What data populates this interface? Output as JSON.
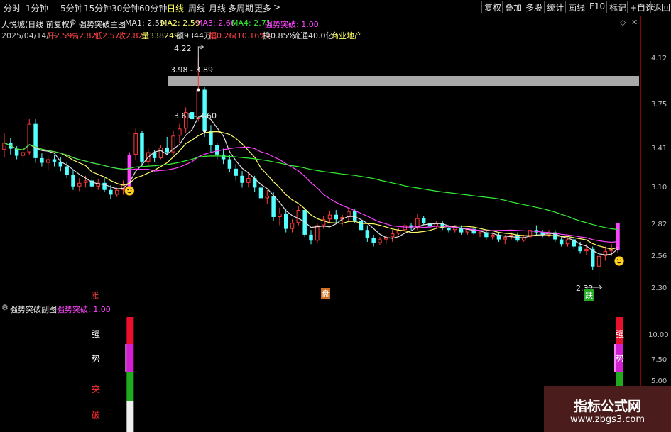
{
  "toolbar": {
    "periods": [
      "分时",
      "1分钟",
      "5分钟",
      "15分钟",
      "30分钟",
      "60分钟",
      "日线",
      "周线",
      "月线",
      "多周期",
      "更多"
    ],
    "active_period": "日线",
    "right_buttons": [
      "复权",
      "叠加",
      "多股",
      "统计",
      "画线",
      "F10",
      "标记",
      "+自选",
      "返回"
    ]
  },
  "header": {
    "stock": "大悦城(日线 前复权)",
    "indicator_name": "强势突破主图",
    "ma1": "MA1: 2.59",
    "ma2": "MA2: 2.59",
    "ma3": "MA3: 2.66",
    "ma4": "MA4: 2.71",
    "signal": "强势突破: 1.00",
    "date": "2025/04/14/一",
    "open": "开2.59",
    "high": "高2.82",
    "low": "低2.57",
    "close": "收2.82",
    "volume": "量338249",
    "amount": "额9344万",
    "change": "幅0.26(10.16%)",
    "turnover": "换0.85%",
    "float": "流通40.0亿",
    "sector": "商业地产"
  },
  "main_axis": [
    "4.12",
    "3.75",
    "3.41",
    "3.10",
    "2.82",
    "2.56",
    "2.30"
  ],
  "price_labels": {
    "high": "4.22",
    "zone1": "3.98 - 3.89",
    "zone2": "3.61 - 3.60",
    "low": "2.32"
  },
  "markers": {
    "zhang": "涨",
    "pan": "盘",
    "die": "跌"
  },
  "sub": {
    "title": "强势突破副图",
    "value": "强势突破: 1.00",
    "axis": [
      "10.00",
      "7.50",
      "5.00"
    ],
    "chars": [
      "强",
      "势",
      "突",
      "破"
    ]
  },
  "colors": {
    "up": "#ff3c3c",
    "down": "#54ffff",
    "ma1": "#e0e0e0",
    "ma2": "#ffff66",
    "ma3": "#ff44ff",
    "ma4": "#33ee33",
    "signal": "#ff44ff"
  },
  "chart_data": {
    "type": "candlestick",
    "ylim": [
      2.22,
      4.35
    ],
    "candles": [
      [
        3.44,
        3.58,
        3.38,
        3.5
      ],
      [
        3.5,
        3.54,
        3.4,
        3.45
      ],
      [
        3.45,
        3.47,
        3.36,
        3.39
      ],
      [
        3.39,
        3.45,
        3.3,
        3.42
      ],
      [
        3.42,
        3.7,
        3.4,
        3.66
      ],
      [
        3.66,
        3.7,
        3.33,
        3.37
      ],
      [
        3.37,
        3.41,
        3.3,
        3.33
      ],
      [
        3.33,
        3.39,
        3.27,
        3.36
      ],
      [
        3.36,
        3.4,
        3.3,
        3.34
      ],
      [
        3.34,
        3.38,
        3.26,
        3.3
      ],
      [
        3.3,
        3.34,
        3.2,
        3.23
      ],
      [
        3.23,
        3.27,
        3.1,
        3.13
      ],
      [
        3.13,
        3.2,
        3.09,
        3.16
      ],
      [
        3.16,
        3.22,
        3.12,
        3.18
      ],
      [
        3.18,
        3.22,
        3.1,
        3.13
      ],
      [
        3.13,
        3.19,
        3.1,
        3.16
      ],
      [
        3.16,
        3.2,
        3.08,
        3.1
      ],
      [
        3.1,
        3.14,
        3.02,
        3.06
      ],
      [
        3.06,
        3.12,
        3.04,
        3.1
      ],
      [
        3.1,
        3.18,
        3.06,
        3.15
      ],
      [
        3.12,
        3.42,
        3.1,
        3.4
      ],
      [
        3.4,
        3.62,
        3.35,
        3.58
      ],
      [
        3.58,
        3.6,
        3.3,
        3.34
      ],
      [
        3.34,
        3.45,
        3.3,
        3.42
      ],
      [
        3.42,
        3.44,
        3.34,
        3.37
      ],
      [
        3.37,
        3.48,
        3.36,
        3.46
      ],
      [
        3.46,
        3.55,
        3.4,
        3.42
      ],
      [
        3.42,
        3.6,
        3.4,
        3.56
      ],
      [
        3.56,
        3.66,
        3.5,
        3.62
      ],
      [
        3.62,
        3.8,
        3.58,
        3.76
      ],
      [
        3.76,
        3.98,
        3.6,
        3.7
      ],
      [
        3.7,
        4.22,
        3.68,
        3.95
      ],
      [
        3.95,
        3.97,
        3.55,
        3.6
      ],
      [
        3.6,
        3.65,
        3.42,
        3.48
      ],
      [
        3.48,
        3.5,
        3.36,
        3.4
      ],
      [
        3.4,
        3.45,
        3.32,
        3.36
      ],
      [
        3.36,
        3.4,
        3.25,
        3.28
      ],
      [
        3.28,
        3.32,
        3.18,
        3.22
      ],
      [
        3.22,
        3.26,
        3.12,
        3.16
      ],
      [
        3.16,
        3.25,
        3.12,
        3.2
      ],
      [
        3.2,
        3.22,
        3.08,
        3.12
      ],
      [
        3.12,
        3.16,
        3.0,
        3.03
      ],
      [
        3.03,
        3.1,
        2.98,
        3.05
      ],
      [
        3.05,
        3.08,
        2.84,
        2.87
      ],
      [
        2.87,
        2.95,
        2.8,
        2.9
      ],
      [
        2.9,
        2.94,
        2.74,
        2.77
      ],
      [
        2.77,
        2.85,
        2.74,
        2.82
      ],
      [
        2.82,
        2.96,
        2.8,
        2.93
      ],
      [
        2.93,
        2.95,
        2.7,
        2.72
      ],
      [
        2.72,
        2.76,
        2.64,
        2.67
      ],
      [
        2.67,
        2.82,
        2.65,
        2.8
      ],
      [
        2.8,
        2.88,
        2.77,
        2.85
      ],
      [
        2.85,
        2.92,
        2.82,
        2.89
      ],
      [
        2.89,
        2.93,
        2.82,
        2.85
      ],
      [
        2.85,
        2.89,
        2.8,
        2.87
      ],
      [
        2.87,
        2.95,
        2.84,
        2.92
      ],
      [
        2.92,
        2.94,
        2.82,
        2.84
      ],
      [
        2.84,
        2.86,
        2.74,
        2.76
      ],
      [
        2.76,
        2.8,
        2.66,
        2.69
      ],
      [
        2.69,
        2.72,
        2.62,
        2.65
      ],
      [
        2.65,
        2.7,
        2.63,
        2.68
      ],
      [
        2.68,
        2.72,
        2.64,
        2.7
      ],
      [
        2.7,
        2.76,
        2.66,
        2.73
      ],
      [
        2.73,
        2.78,
        2.72,
        2.76
      ],
      [
        2.76,
        2.82,
        2.74,
        2.8
      ],
      [
        2.8,
        2.82,
        2.76,
        2.78
      ],
      [
        2.78,
        2.9,
        2.76,
        2.86
      ],
      [
        2.86,
        2.88,
        2.8,
        2.82
      ],
      [
        2.82,
        2.84,
        2.77,
        2.79
      ],
      [
        2.79,
        2.84,
        2.77,
        2.82
      ],
      [
        2.82,
        2.84,
        2.76,
        2.78
      ],
      [
        2.78,
        2.8,
        2.74,
        2.76
      ],
      [
        2.76,
        2.8,
        2.74,
        2.78
      ],
      [
        2.78,
        2.8,
        2.72,
        2.74
      ],
      [
        2.74,
        2.78,
        2.72,
        2.77
      ],
      [
        2.77,
        2.78,
        2.72,
        2.73
      ],
      [
        2.73,
        2.76,
        2.7,
        2.74
      ],
      [
        2.74,
        2.76,
        2.68,
        2.7
      ],
      [
        2.7,
        2.74,
        2.68,
        2.72
      ],
      [
        2.72,
        2.74,
        2.66,
        2.68
      ],
      [
        2.68,
        2.72,
        2.64,
        2.7
      ],
      [
        2.7,
        2.74,
        2.68,
        2.72
      ],
      [
        2.72,
        2.74,
        2.66,
        2.67
      ],
      [
        2.67,
        2.72,
        2.66,
        2.7
      ],
      [
        2.7,
        2.78,
        2.68,
        2.76
      ],
      [
        2.76,
        2.8,
        2.72,
        2.74
      ],
      [
        2.74,
        2.76,
        2.7,
        2.72
      ],
      [
        2.72,
        2.76,
        2.7,
        2.74
      ],
      [
        2.74,
        2.76,
        2.66,
        2.68
      ],
      [
        2.68,
        2.7,
        2.62,
        2.64
      ],
      [
        2.64,
        2.7,
        2.62,
        2.68
      ],
      [
        2.68,
        2.7,
        2.6,
        2.62
      ],
      [
        2.62,
        2.66,
        2.56,
        2.58
      ],
      [
        2.58,
        2.64,
        2.55,
        2.6
      ],
      [
        2.6,
        2.62,
        2.42,
        2.45
      ],
      [
        2.45,
        2.58,
        2.32,
        2.54
      ],
      [
        2.54,
        2.62,
        2.5,
        2.58
      ],
      [
        2.58,
        2.64,
        2.54,
        2.61
      ],
      [
        2.59,
        2.82,
        2.57,
        2.82
      ]
    ]
  }
}
